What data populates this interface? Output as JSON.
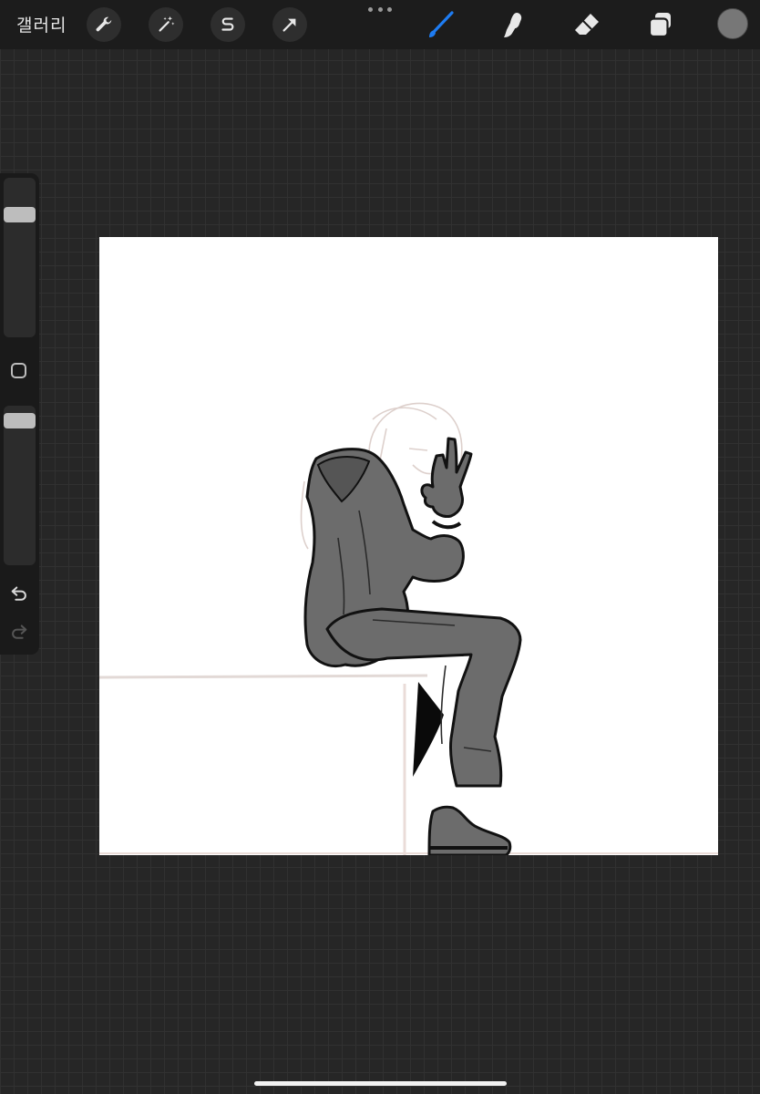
{
  "toolbar": {
    "gallery_label": "갤러리",
    "left_tools": [
      "wrench-icon",
      "magic-wand-icon",
      "selection-s-icon",
      "arrow-transform-icon"
    ],
    "right_tools": [
      "brush-icon",
      "smudge-icon",
      "eraser-icon",
      "layers-icon"
    ],
    "active_tool": "brush-icon",
    "accent_color": "#1e7cf2",
    "current_color": "#777777"
  },
  "sidebar": {
    "brush_size": 0.2,
    "brush_opacity": 0.05,
    "controls": [
      "undo-icon",
      "redo-icon"
    ]
  }
}
